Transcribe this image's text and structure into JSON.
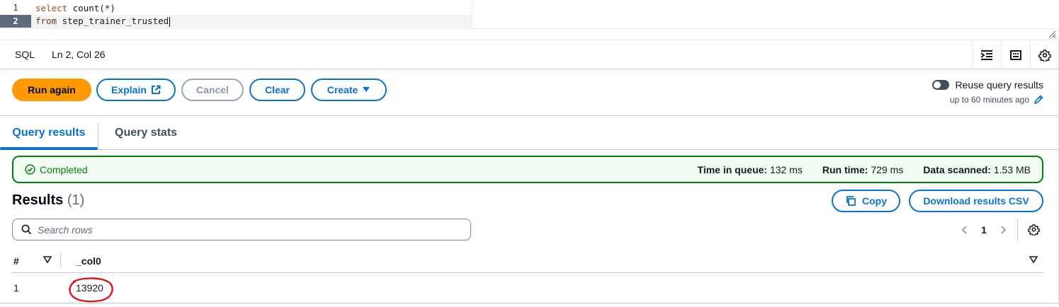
{
  "editor": {
    "lines": [
      {
        "number": "1",
        "keyword": "select",
        "rest": " count(*)"
      },
      {
        "number": "2",
        "keyword": "from",
        "rest": " step_trainer_trusted"
      }
    ]
  },
  "statusbar": {
    "language": "SQL",
    "cursor_position": "Ln 2, Col 26",
    "icons": [
      "format-indent-icon",
      "keyboard-icon",
      "settings-gear-icon"
    ]
  },
  "actions": {
    "run_again": "Run again",
    "explain": "Explain",
    "cancel": "Cancel",
    "clear": "Clear",
    "create": "Create",
    "reuse_label": "Reuse query results",
    "reuse_sub": "up to 60 minutes ago",
    "reuse_enabled": false
  },
  "tabs": [
    {
      "label": "Query results",
      "active": true
    },
    {
      "label": "Query stats",
      "active": false
    }
  ],
  "alert": {
    "status": "Completed",
    "metrics": [
      {
        "label": "Time in queue:",
        "value": "132 ms"
      },
      {
        "label": "Run time:",
        "value": "729 ms"
      },
      {
        "label": "Data scanned:",
        "value": "1.53 MB"
      }
    ]
  },
  "results": {
    "title": "Results",
    "count": "(1)",
    "copy_label": "Copy",
    "download_label": "Download results CSV",
    "search_placeholder": "Search rows",
    "current_page": "1",
    "columns": [
      "#",
      "_col0"
    ],
    "rows": [
      {
        "index": "1",
        "value": "13920"
      }
    ]
  },
  "colors": {
    "accent": "#0972d3",
    "primary_button": "#ff9900",
    "success": "#037f0c",
    "annotation": "#e0121b"
  }
}
